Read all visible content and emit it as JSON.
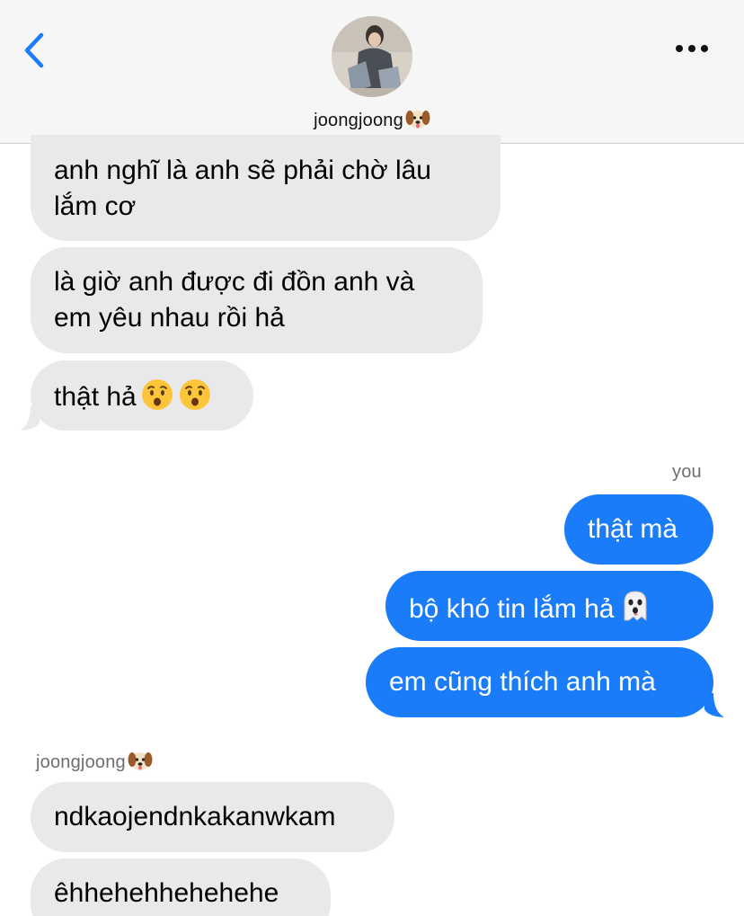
{
  "header": {
    "contact_name": "joongjoong",
    "back_icon": "chevron-left-icon",
    "more_icon": "ellipsis-icon"
  },
  "colors": {
    "outgoing_bubble": "#1a7cf9",
    "incoming_bubble": "#e9e9eb",
    "accent": "#1a7cf9"
  },
  "incoming_group_1": [
    {
      "line1": "anh nghĩ là anh sẽ phải chờ lâu",
      "line2": "lắm cơ"
    },
    {
      "line1": "là giờ anh được đi đồn anh và",
      "line2": "em yêu nhau rồi hả"
    },
    {
      "text": "thật hả",
      "emoji": "hushed-face-icon x2"
    }
  ],
  "outgoing_group": {
    "sender_label": "you",
    "messages": [
      {
        "text": "thật mà"
      },
      {
        "text": "bộ khó tin lắm hả",
        "emoji": "ghost-icon"
      },
      {
        "text": "em cũng thích anh mà"
      }
    ]
  },
  "incoming_group_2": {
    "sender_label": "joongjoong",
    "messages": [
      {
        "text": "ndkaojendnkakanwkam"
      },
      {
        "text": "êhhehehhehehehe"
      }
    ]
  }
}
